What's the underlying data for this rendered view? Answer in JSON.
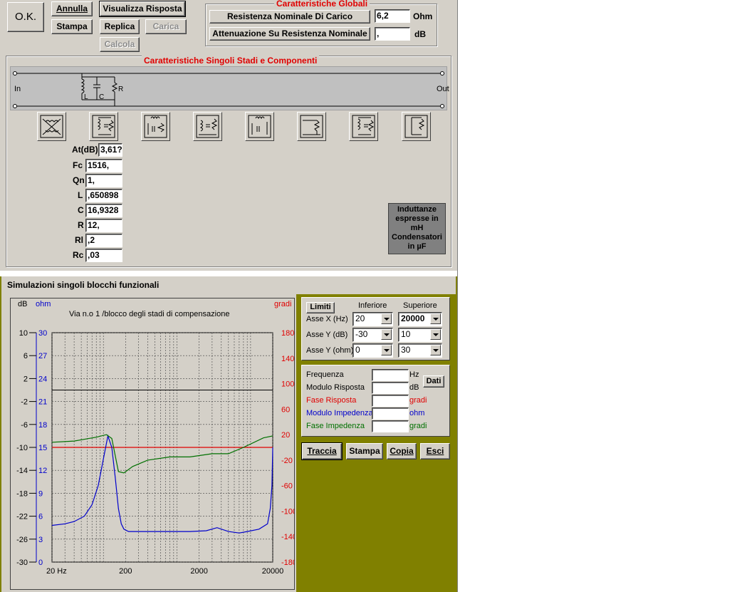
{
  "toolbar": {
    "ok_label": "O.K.",
    "annulla_label": "Annulla",
    "visualizza_label": "Visualizza Risposta",
    "stampa_label": "Stampa",
    "replica_label": "Replica",
    "carica_label": "Carica",
    "calcola_label": "Calcola"
  },
  "global": {
    "title": "Caratteristiche Globali",
    "resistance_button": "Resistenza Nominale Di Carico",
    "resistance_value": "6,2",
    "resistance_unit": "Ohm",
    "attenuation_button": "Attenuazione Su Resistenza Nominale",
    "attenuation_value": ",",
    "attenuation_unit": "dB"
  },
  "stages": {
    "title": "Caratteristiche Singoli Stadi e Componenti",
    "in_label": "In",
    "out_label": "Out",
    "circuit_labels": {
      "l": "L",
      "c": "C",
      "r": "R"
    },
    "buttons": [
      "transformer-x-icon",
      "parallel-lcr-icon",
      "series-lc-r-icon",
      "series-rc-lc-icon",
      "series-lc-parallel-icon",
      "series-r-icon",
      "parallel-lcr-2-icon",
      "shunt-r-icon"
    ]
  },
  "params": [
    {
      "label": "At(dB)",
      "value": "3,61?"
    },
    {
      "label": "Fc",
      "value": "1516,"
    },
    {
      "label": "Qn",
      "value": "1,"
    },
    {
      "label": "L",
      "value": ",650898"
    },
    {
      "label": "C",
      "value": "16,9328"
    },
    {
      "label": "R",
      "value": "12,"
    },
    {
      "label": "Rl",
      "value": ",2"
    },
    {
      "label": "Rc",
      "value": ",03"
    }
  ],
  "note": {
    "text": "Induttanze espresse in mH Condensatori in µF"
  },
  "sim": {
    "title": "Simulazioni singoli blocchi funzionali",
    "limits": {
      "button": "Limiti",
      "col_lower": "Inferiore",
      "col_upper": "Superiore",
      "rows": [
        {
          "label": "Asse X (Hz)",
          "lower": "20",
          "upper": "20000"
        },
        {
          "label": "Asse Y (dB)",
          "lower": "-30",
          "upper": "10"
        },
        {
          "label": "Asse Y (ohm)",
          "lower": "0",
          "upper": "30"
        }
      ]
    },
    "data_panel": {
      "button": "Dati",
      "rows": [
        {
          "label": "Frequenza",
          "unit": "Hz",
          "value": ""
        },
        {
          "label": "Modulo Risposta",
          "unit": "dB",
          "value": ""
        },
        {
          "label": "Fase Risposta",
          "unit": "gradi",
          "value": ""
        },
        {
          "label": "Modulo Impedenza",
          "unit": "ohm",
          "value": ""
        },
        {
          "label": "Fase Impedenza",
          "unit": "gradi",
          "value": ""
        }
      ]
    },
    "actions": {
      "traccia": "Traccia",
      "stampa": "Stampa",
      "copia": "Copia",
      "esci": "Esci"
    }
  },
  "colors": {
    "window": "#d4d0c8",
    "olive": "#808000",
    "response": "#e00000",
    "impedance": "#0000cc",
    "phase": "#007000",
    "title_red": "#e00000"
  },
  "chart_data": {
    "type": "line",
    "title": "Via n.o 1 /blocco degli stadi di compensazione",
    "x_scale": "log",
    "xlim": [
      20,
      20000
    ],
    "x_tick_labels": [
      "20 Hz",
      "200",
      "2000",
      "20000"
    ],
    "y_left_db": {
      "label": "dB",
      "lim": [
        -30,
        10
      ],
      "ticks": [
        "10",
        "6",
        "2",
        "-2",
        "-6",
        "-10",
        "-14",
        "-18",
        "-22",
        "-26",
        "-30"
      ]
    },
    "y_left_ohm": {
      "label": "ohm",
      "lim": [
        0,
        30
      ],
      "ticks": [
        "30",
        "27",
        "24",
        "21",
        "18",
        "15",
        "12",
        "9",
        "6",
        "3",
        "0"
      ]
    },
    "y_right_deg": {
      "label": "gradi",
      "lim": [
        -180,
        180
      ],
      "ticks": [
        "180",
        "140",
        "100",
        "60",
        "20",
        "-20",
        "-60",
        "-100",
        "-140",
        "-180"
      ]
    },
    "grid": true,
    "series": [
      {
        "axis": "db",
        "color": "#e00000",
        "x": [
          20,
          20000
        ],
        "y": [
          -10,
          -10
        ]
      },
      {
        "axis": "ohm",
        "color": "#0000cc",
        "x": [
          20,
          30,
          40,
          55,
          70,
          85,
          100,
          115,
          130,
          145,
          160,
          175,
          190,
          220,
          260,
          400,
          800,
          1500,
          2500,
          3500,
          5000,
          7000,
          9000,
          13000,
          17000,
          18500,
          19500,
          20000
        ],
        "y": [
          4.8,
          5.0,
          5.3,
          6.0,
          7.5,
          10.0,
          13.5,
          16.5,
          15.0,
          11.0,
          7.0,
          5.0,
          4.3,
          4.0,
          4.0,
          4.0,
          4.0,
          4.0,
          4.1,
          4.5,
          4.0,
          3.8,
          4.0,
          4.3,
          5.0,
          7.0,
          10.0,
          15.0
        ]
      },
      {
        "axis": "deg",
        "color": "#007000",
        "x": [
          20,
          40,
          80,
          110,
          130,
          160,
          190,
          250,
          400,
          800,
          1500,
          3000,
          5000,
          8000,
          15000,
          20000
        ],
        "y": [
          8,
          10,
          16,
          20,
          14,
          -38,
          -40,
          -30,
          -20,
          -15,
          -15,
          -10,
          -10,
          0,
          15,
          18
        ]
      }
    ]
  }
}
